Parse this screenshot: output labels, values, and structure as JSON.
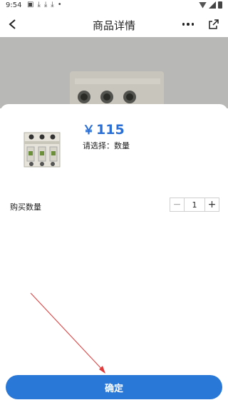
{
  "status_bar": {
    "time": "9:54"
  },
  "header": {
    "title": "商品详情"
  },
  "product": {
    "price_symbol": "￥",
    "price_value": "115",
    "selection_text": "请选择：数量"
  },
  "quantity": {
    "label": "购买数量",
    "minus": "−",
    "plus": "+",
    "value": "1"
  },
  "confirm": {
    "label": "确定"
  },
  "colors": {
    "accent": "#2978d8",
    "price": "#2a6fd6"
  }
}
